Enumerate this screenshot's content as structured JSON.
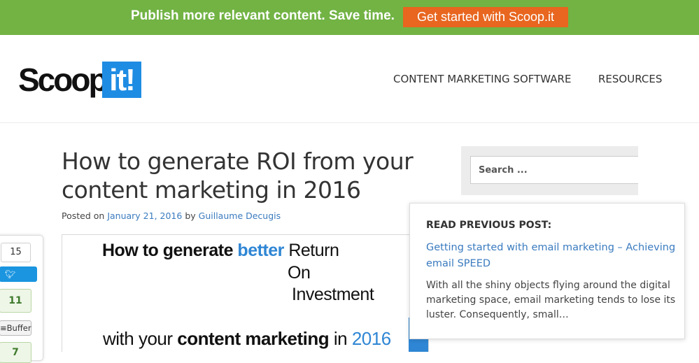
{
  "promo_bar": {
    "text": "Publish more relevant content. Save time.",
    "cta_label": "Get started with Scoop.it",
    "background": "#72b344",
    "cta_color": "#e8661f"
  },
  "header": {
    "logo_text": "Scoop.",
    "logo_box_text": "it!",
    "logo_accent": "#1f8ce3",
    "nav": [
      {
        "label": "CONTENT MARKETING SOFTWARE"
      },
      {
        "label": "RESOURCES"
      }
    ]
  },
  "post": {
    "title": "How to generate ROI from your content marketing in 2016",
    "posted_on_label": "Posted on",
    "date": "January 21, 2016",
    "by_label": "by",
    "author": "Guillaume Decugis",
    "image": {
      "line1_a": "How to generate ",
      "line1_b": "better",
      "line1_c": " R",
      "line1_d": "eturn",
      "line2_a": "O",
      "line2_b": "n",
      "line3_a": "I",
      "line3_b": "nvestment",
      "line4_a": "with your ",
      "line4_b": "content marketing",
      "line4_c": " in ",
      "line4_d": "2016"
    }
  },
  "share": {
    "tweet_count": "15",
    "tweet_label": "Tweet",
    "buffer_count": "11",
    "buffer_label": "Buffer",
    "third_count": "7"
  },
  "sidebar": {
    "search_placeholder": "Search ..."
  },
  "previous_post": {
    "heading": "READ PREVIOUS POST:",
    "link": "Getting started with email marketing – Achieving email SPEED",
    "excerpt": "With all the shiny objects flying around the digital marketing space, email marketing tends to lose its luster. Consequently, small…"
  }
}
